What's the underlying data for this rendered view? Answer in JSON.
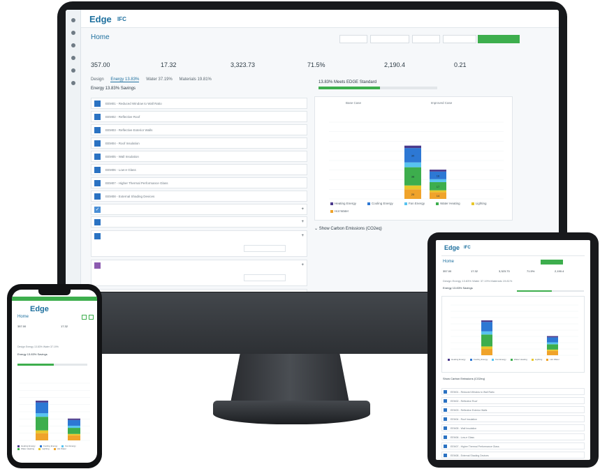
{
  "app": {
    "logo": "Edge",
    "logo_sub": "IFC",
    "project_name": "Home",
    "top_links": [
      "",
      "",
      "",
      ""
    ],
    "rail_icons": [
      "menu-icon",
      "home-icon",
      "project-icon",
      "settings-icon",
      "help-icon",
      "user-icon"
    ]
  },
  "header": {
    "toggles": [
      {
        "label": "",
        "active": false
      },
      {
        "label": "",
        "active": false
      },
      {
        "label": "",
        "active": false
      },
      {
        "label": "",
        "active": false
      },
      {
        "label": "",
        "active": true
      }
    ]
  },
  "metrics": [
    {
      "label": "",
      "value": "357.00"
    },
    {
      "label": "",
      "value": "17.32"
    },
    {
      "label": "",
      "value": "3,323.73"
    },
    {
      "label": "",
      "value": "71.5%"
    },
    {
      "label": "",
      "value": "2,190.4"
    },
    {
      "label": "",
      "value": "0.21"
    }
  ],
  "tabs": [
    "Design",
    "Energy 13.83%",
    "Water 37.19%",
    "Materials 19.81%"
  ],
  "active_tab": 1,
  "energy_section": {
    "heading": "Energy 13.83% Savings",
    "subtitle": ""
  },
  "measures": [
    {
      "text": "EEM01 - Reduced Window to Wall Ratio",
      "state": "on"
    },
    {
      "text": "EEM02 - Reflective Roof",
      "state": "on"
    },
    {
      "text": "EEM03 - Reflective Exterior Walls",
      "state": "on"
    },
    {
      "text": "EEM04 - Roof Insulation",
      "state": "on"
    },
    {
      "text": "EEM05 - Wall Insulation",
      "state": "on"
    },
    {
      "text": "EEM06 - Low-e Glass",
      "state": "on"
    },
    {
      "text": "EEM07 - Higher Thermal Performance Glass",
      "state": "on"
    },
    {
      "text": "EEM08 - External Shading Devices",
      "state": "on"
    },
    {
      "text": "",
      "state": "check"
    },
    {
      "text": "",
      "state": "on"
    },
    {
      "text": "",
      "state": "on"
    },
    {
      "text": "",
      "state": "off"
    },
    {
      "text": "",
      "state": "orange"
    }
  ],
  "progress": {
    "label": "13.83% Meets EDGE Standard",
    "fraction": 0.52
  },
  "chart": {
    "column_heads": [
      "Base Case",
      "",
      "Improved Case",
      ""
    ],
    "legend": [
      {
        "label": "Heating Energy",
        "color": "#4b3a8c"
      },
      {
        "label": "Cooling Energy",
        "color": "#2d78d4"
      },
      {
        "label": "Fan Energy",
        "color": "#58c3f0"
      },
      {
        "label": "Water Heating",
        "color": "#3dae4d"
      },
      {
        "label": "Lighting",
        "color": "#e8c72a"
      },
      {
        "label": "Hot Water",
        "color": "#f0a32a"
      }
    ],
    "ylabel": ""
  },
  "chart_data": {
    "type": "bar",
    "categories": [
      "Base Case",
      "Improved Case"
    ],
    "series": [
      {
        "name": "Heating Energy",
        "values": [
          5,
          4
        ]
      },
      {
        "name": "Cooling Energy",
        "values": [
          30,
          16
        ]
      },
      {
        "name": "Fan Energy",
        "values": [
          10,
          6
        ]
      },
      {
        "name": "Water Heating",
        "values": [
          38,
          17
        ]
      },
      {
        "name": "Lighting",
        "values": [
          8,
          4
        ]
      },
      {
        "name": "Hot Water",
        "values": [
          20,
          14
        ]
      }
    ],
    "ylim": [
      0,
      160
    ]
  },
  "carbon": {
    "heading": "Show Carbon Emissions (CO2eq)",
    "text": ""
  },
  "ipad": {
    "section": "Energy 13.83% Savings",
    "tabs": [
      "Design",
      "Energy 13.83%",
      "Water 37.19%",
      "Materials 19.81%"
    ]
  },
  "iphone": {
    "title": "Home",
    "section": "Energy 13.83% Savings",
    "tabs": [
      "Design",
      "Energy 13.83%",
      "Water 37.19%"
    ]
  }
}
